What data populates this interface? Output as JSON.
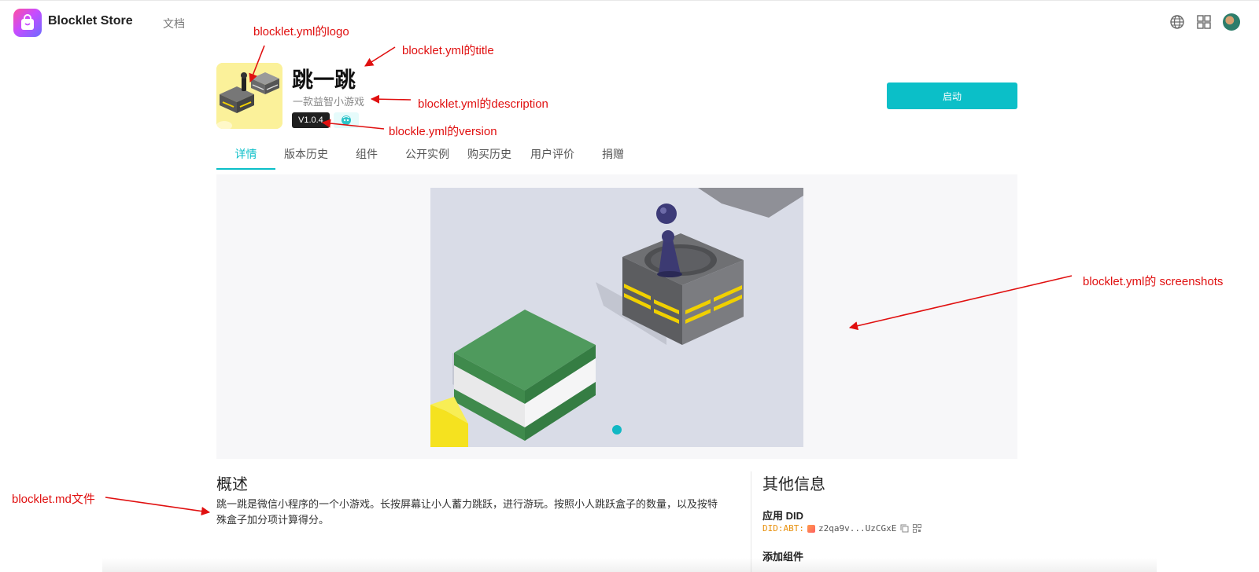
{
  "header": {
    "brand_name": "Blocklet Store",
    "nav_docs": "文档",
    "icons": [
      "globe-icon",
      "apps-grid-icon",
      "user-avatar"
    ]
  },
  "app": {
    "title": "跳一跳",
    "description": "一款益智小游戏",
    "version": "V1.0.4",
    "launch_label": "启动"
  },
  "tabs": [
    {
      "label": "详情",
      "active": true
    },
    {
      "label": "版本历史",
      "active": false
    },
    {
      "label": "组件",
      "active": false
    },
    {
      "label": "公开实例",
      "active": false
    },
    {
      "label": "购买历史",
      "active": false
    },
    {
      "label": "用户评价",
      "active": false
    },
    {
      "label": "捐赠",
      "active": false
    }
  ],
  "overview": {
    "title": "概述",
    "text": "跳一跳是微信小程序的一个小游戏。长按屏幕让小人蓄力跳跃，进行游玩。按照小人跳跃盒子的数量，以及按特殊盒子加分项计算得分。"
  },
  "other_info": {
    "title": "其他信息",
    "did_label": "应用 DID",
    "did_prefix": "DID:ABT:",
    "did_value": "z2qa9v...UzCGxE",
    "add_component_label": "添加组件"
  },
  "annotations": {
    "logo": "blocklet.yml的logo",
    "title": "blocklet.yml的title",
    "description": "blocklet.yml的description",
    "version": "blockle.yml的version",
    "screenshots": "blocklet.yml的 screenshots",
    "md": "blocklet.md文件"
  },
  "colors": {
    "accent": "#0bbfc8",
    "annotation": "#e01010"
  }
}
